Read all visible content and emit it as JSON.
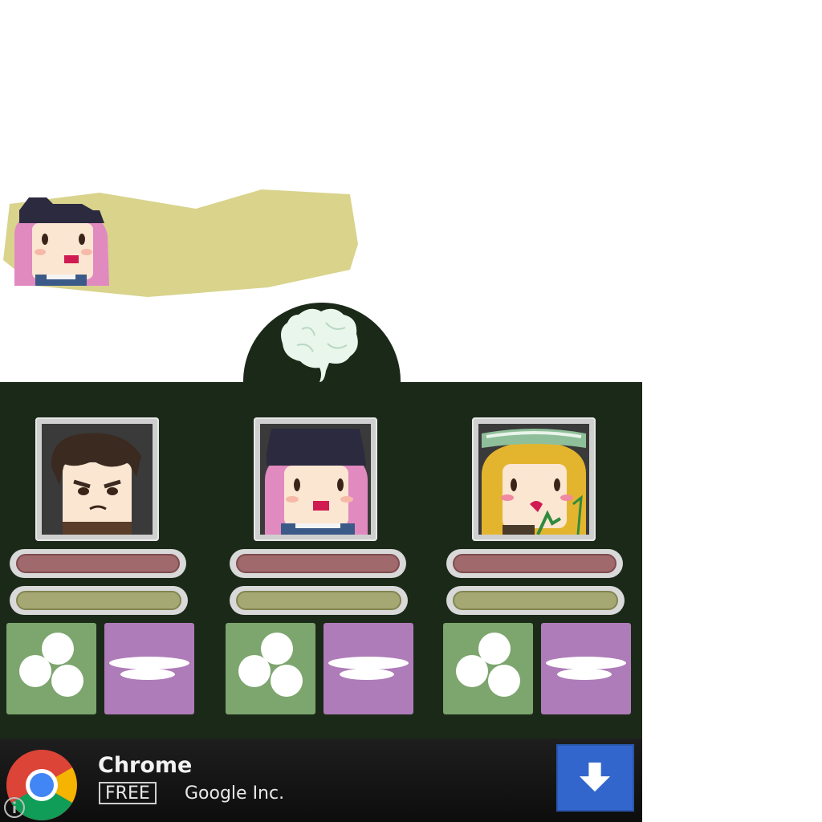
{
  "speech": {
    "speaker_icon": "pink-hair-girl-avatar-icon",
    "bubble_color": "#d9d38c"
  },
  "board": {
    "background_color": "#1b2a18",
    "header_icon": "brain-icon",
    "characters": [
      {
        "portrait_icon": "brown-hair-boy-portrait-icon",
        "health_color": "#a06a6c",
        "stamina_color": "#a6a873",
        "action_left_icon": "three-circles-icon",
        "action_right_icon": "flat-disc-icon"
      },
      {
        "portrait_icon": "pink-hair-girl-portrait-icon",
        "health_color": "#a06a6c",
        "stamina_color": "#a6a873",
        "action_left_icon": "three-circles-icon",
        "action_right_icon": "flat-disc-icon"
      },
      {
        "portrait_icon": "blonde-hair-girl-portrait-icon",
        "health_color": "#a06a6c",
        "stamina_color": "#a6a873",
        "action_left_icon": "three-circles-icon",
        "action_right_icon": "flat-disc-icon"
      }
    ]
  },
  "ad": {
    "app_name": "Chrome",
    "price_badge": "FREE",
    "publisher": "Google Inc.",
    "logo_icon": "chrome-logo-icon",
    "download_icon": "download-arrow-icon",
    "info_icon": "info-icon",
    "download_color": "#3366cc"
  }
}
